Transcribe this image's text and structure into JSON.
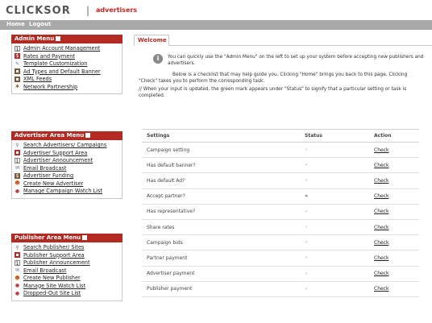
{
  "header": {
    "logo": "CLICKSOR",
    "separator": "|",
    "subtitle": "advertisers"
  },
  "nav": {
    "home": "Home",
    "logout": "Logout"
  },
  "admin_menu": {
    "title": "Admin Menu",
    "items": [
      {
        "label": "Admin Account Management",
        "icon": "account-icon"
      },
      {
        "label": "Rates and Payment",
        "icon": "payment-icon"
      },
      {
        "label": "Template Customization",
        "icon": "template-icon"
      },
      {
        "label": "Ad Types and Default Banner",
        "icon": "banner-icon"
      },
      {
        "label": "XML Feeds",
        "icon": "xml-icon"
      },
      {
        "label": "Network Partnership",
        "icon": "network-icon"
      }
    ]
  },
  "advertiser_menu": {
    "title": "Advertiser Area Menu",
    "items": [
      {
        "label": "Search Advertisers/ Campaigns",
        "icon": "search-icon"
      },
      {
        "label": "Advertiser Support Area",
        "icon": "support-icon"
      },
      {
        "label": "Advertiser Announcement",
        "icon": "announcement-icon"
      },
      {
        "label": "Email Broadcast",
        "icon": "email-icon"
      },
      {
        "label": "Advertiser Funding",
        "icon": "funding-icon"
      },
      {
        "label": "Create New Advertiser",
        "icon": "new-user-icon"
      },
      {
        "label": "Manage Campaign Watch List",
        "icon": "watch-list-icon"
      }
    ]
  },
  "publisher_menu": {
    "title": "Publisher Area Menu",
    "items": [
      {
        "label": "Search Publisher/ Sites",
        "icon": "search-icon"
      },
      {
        "label": "Publisher Support Area",
        "icon": "support-icon"
      },
      {
        "label": "Publisher Announcement",
        "icon": "announcement-icon"
      },
      {
        "label": "Email Broadcast",
        "icon": "email-icon"
      },
      {
        "label": "Create New Publisher",
        "icon": "new-user-icon"
      },
      {
        "label": "Manage Site Watch List",
        "icon": "watch-list-icon"
      },
      {
        "label": "Dropped-Out Site List",
        "icon": "dropped-list-icon"
      }
    ]
  },
  "main": {
    "tab": "Welcome",
    "info_line1": "You can quickly use the \"Admin Menu\" on the left to set up your system before accepting new publishers and advertisers.",
    "info_line2": "Below is a checklist that may help guide you. Clicking \"Home\" brings you back to this page. Clicking \"Check\" takes you to perform the corresponding task.",
    "info_line3": "// When your input is updated, the green mark appears under \"Status\" to signify that a particular setting or task is completed.",
    "table": {
      "headers": [
        "Settings",
        "Status",
        "Action"
      ],
      "rows": [
        {
          "setting": "Campaign setting",
          "status": "✓",
          "action": "Check"
        },
        {
          "setting": "Has default banner?",
          "status": "✓",
          "action": "Check"
        },
        {
          "setting": "Has default Ad?",
          "status": "✓",
          "action": "Check"
        },
        {
          "setting": "Accept partner?",
          "status": "✱",
          "action": "Check"
        },
        {
          "setting": "Has representative?",
          "status": "✓",
          "action": "Check"
        },
        {
          "setting": "Share rates",
          "status": "✓",
          "action": "Check"
        },
        {
          "setting": "Campaign bids",
          "status": "✓",
          "action": "Check"
        },
        {
          "setting": "Partner payment",
          "status": "✓",
          "action": "Check"
        },
        {
          "setting": "Advertiser payment",
          "status": "✓",
          "action": "Check"
        },
        {
          "setting": "Publisher payment",
          "status": "✓",
          "action": "Check"
        }
      ]
    }
  },
  "colors": {
    "accent": "#b32a22",
    "navbar": "#a8a8a8"
  }
}
